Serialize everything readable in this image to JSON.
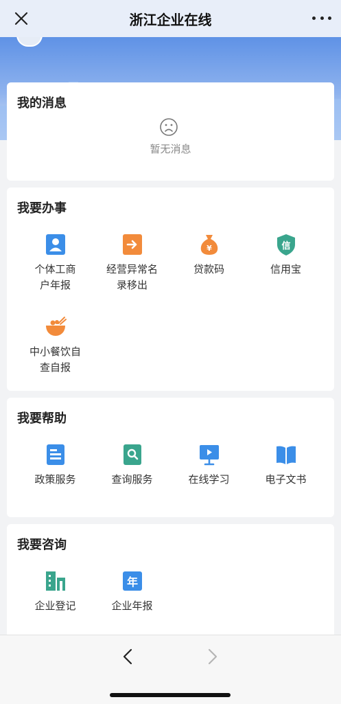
{
  "header": {
    "title": "浙江企业在线"
  },
  "messages": {
    "title": "我的消息",
    "empty_text": "暂无消息"
  },
  "affairs": {
    "title": "我要办事",
    "items": [
      {
        "label": "个体工商户年报",
        "line1": "个体工商",
        "line2": "户年报",
        "icon": "person-card-icon",
        "color": "#3b8ee8"
      },
      {
        "label": "经营异常名录移出",
        "line1": "经营异常名",
        "line2": "录移出",
        "icon": "arrow-out-icon",
        "color": "#f28b3b"
      },
      {
        "label": "贷款码",
        "line1": "贷款码",
        "line2": "",
        "icon": "money-bag-icon",
        "color": "#f28b3b"
      },
      {
        "label": "信用宝",
        "line1": "信用宝",
        "line2": "",
        "icon": "shield-credit-icon",
        "color": "#3aa58d"
      },
      {
        "label": "中小餐饮自查自报",
        "line1": "中小餐饮自",
        "line2": "查自报",
        "icon": "food-bowl-icon",
        "color": "#f28b3b"
      }
    ]
  },
  "help": {
    "title": "我要帮助",
    "items": [
      {
        "label": "政策服务",
        "icon": "policy-doc-icon",
        "color": "#3b8ee8"
      },
      {
        "label": "查询服务",
        "icon": "search-doc-icon",
        "color": "#3aa58d"
      },
      {
        "label": "在线学习",
        "icon": "presentation-icon",
        "color": "#3b8ee8"
      },
      {
        "label": "电子文书",
        "icon": "book-icon",
        "color": "#3b8ee8"
      }
    ]
  },
  "consult": {
    "title": "我要咨询",
    "items": [
      {
        "label": "企业登记",
        "icon": "building-icon",
        "color": "#3aa58d"
      },
      {
        "label": "企业年报",
        "icon": "year-report-icon",
        "color": "#3b8ee8",
        "glyph": "年"
      }
    ]
  },
  "shield_glyph": "信"
}
